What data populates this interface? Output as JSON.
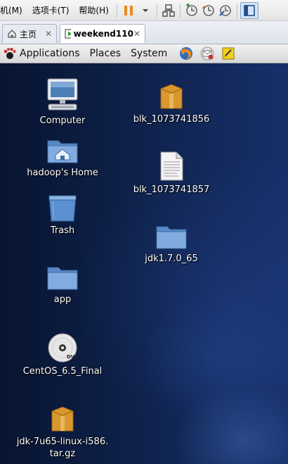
{
  "vmware": {
    "menu": [
      "机(M)",
      "选项卡(T)",
      "帮助(H)"
    ],
    "tabs": [
      {
        "label": "主页"
      },
      {
        "label": "weekend110"
      }
    ]
  },
  "panel": {
    "menus": [
      "Applications",
      "Places",
      "System"
    ],
    "launchers": [
      "firefox-icon",
      "mail-icon",
      "notes-icon"
    ]
  },
  "desktop": {
    "icons": [
      {
        "label": "Computer",
        "icon": "computer-icon"
      },
      {
        "label": "hadoop's Home",
        "icon": "home-folder-icon"
      },
      {
        "label": "Trash",
        "icon": "trash-icon"
      },
      {
        "label": "app",
        "icon": "folder-icon"
      },
      {
        "label": "CentOS_6.5_Final",
        "icon": "dvd-icon"
      },
      {
        "label": "jdk-7u65-linux-i586.\ntar.gz",
        "icon": "archive-icon"
      },
      {
        "label": "blk_1073741856",
        "icon": "archive-icon"
      },
      {
        "label": "blk_1073741857",
        "icon": "text-file-icon"
      },
      {
        "label": "jdk1.7.0_65",
        "icon": "folder-icon"
      }
    ]
  },
  "colors": {
    "desktop_bg": "#0e2149",
    "folder_blue": "#6f9fd8",
    "archive_orange": "#d9982f"
  }
}
